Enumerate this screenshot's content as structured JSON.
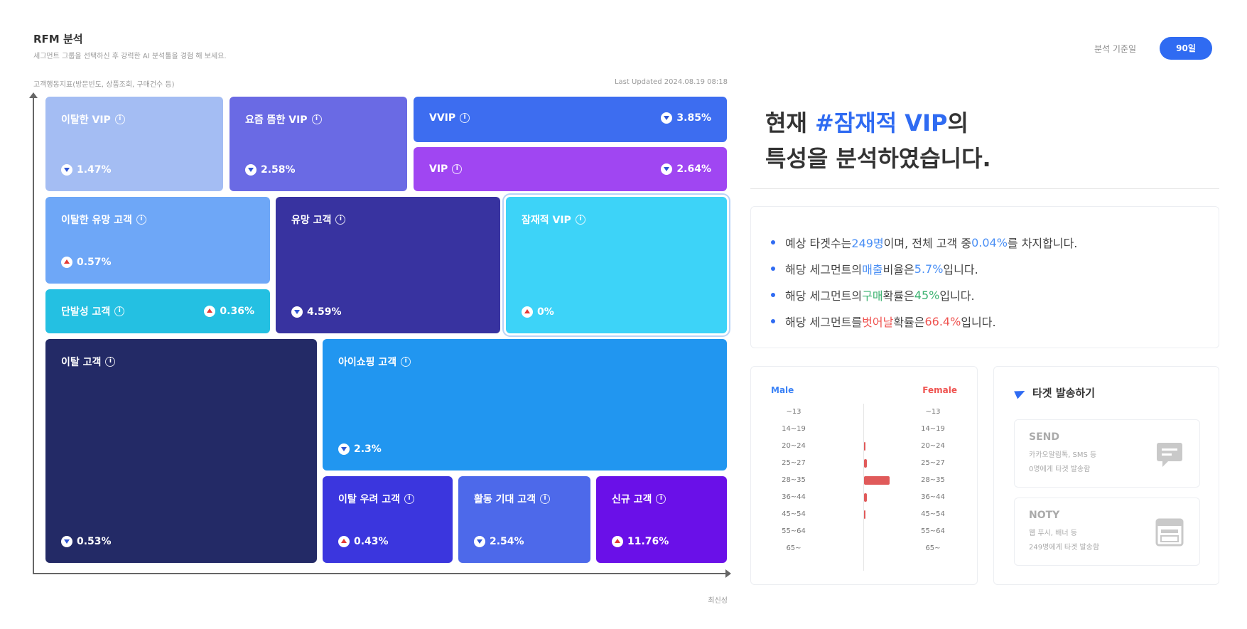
{
  "header": {
    "title": "RFM 분석",
    "subtitle": "세그먼트 그룹을 선택하신 후 강력한 AI 분석툴을 경험 해 보세요.",
    "period_label": "분석 기준일",
    "period_value": "90일"
  },
  "chart_meta": {
    "y_axis_label": "고객행동지표(방문빈도, 상품조회, 구매건수 등)",
    "last_updated": "Last Updated 2024.08.19 08:18",
    "x_axis_label": "최신성"
  },
  "segments": [
    {
      "name": "이탈한 VIP",
      "value": "1.47%",
      "trend": "down",
      "color": "#a4bdf3"
    },
    {
      "name": "요즘 뜸한 VIP",
      "value": "2.58%",
      "trend": "down",
      "color": "#6a6ae4"
    },
    {
      "name": "VVIP",
      "value": "3.85%",
      "trend": "down",
      "color": "#3d6df0"
    },
    {
      "name": "VIP",
      "value": "2.64%",
      "trend": "down",
      "color": "#a046f2"
    },
    {
      "name": "이탈한 유망 고객",
      "value": "0.57%",
      "trend": "up",
      "color": "#6ea7f7"
    },
    {
      "name": "유망 고객",
      "value": "4.59%",
      "trend": "down",
      "color": "#3833a0"
    },
    {
      "name": "잠재적 VIP",
      "value": "0%",
      "trend": "up",
      "color": "#3dd3f8"
    },
    {
      "name": "단발성 고객",
      "value": "0.36%",
      "trend": "up",
      "color": "#24c0e2"
    },
    {
      "name": "이탈 고객",
      "value": "0.53%",
      "trend": "down",
      "color": "#232a66"
    },
    {
      "name": "아이쇼핑 고객",
      "value": "2.3%",
      "trend": "down",
      "color": "#2196f0"
    },
    {
      "name": "이탈 우려 고객",
      "value": "0.43%",
      "trend": "up",
      "color": "#3b36de"
    },
    {
      "name": "활동 기대 고객",
      "value": "2.54%",
      "trend": "down",
      "color": "#4d69ea"
    },
    {
      "name": "신규 고객",
      "value": "11.76%",
      "trend": "up",
      "color": "#6a10e8"
    }
  ],
  "analysis": {
    "headline_prefix": "현재 ",
    "headline_highlight": "#잠재적 VIP",
    "headline_suffix": "의",
    "headline_line2": "특성을 분석하였습니다.",
    "bullets": [
      {
        "p1": "예상 타겟수는 ",
        "v1": "249명",
        "p2": "이며, 전체 고객 중 ",
        "v2": "0.04%",
        "p3": "를 차지합니다."
      },
      {
        "p1": "해당 세그먼트의 ",
        "v1": "매출",
        "p2": "비율은 ",
        "v2": "5.7%",
        "p3": "입니다."
      },
      {
        "p1": "해당 세그먼트의 ",
        "v1": "구매",
        "p2": "확률은 ",
        "v2": "45%",
        "p3": "입니다."
      },
      {
        "p1": "해당 세그먼트를 ",
        "v1": "벗어날",
        "p2": "확률은 ",
        "v2": "66.4%",
        "p3": "입니다."
      }
    ]
  },
  "pyramid": {
    "male_label": "Male",
    "female_label": "Female",
    "age_groups": [
      "~13",
      "14~19",
      "20~24",
      "25~27",
      "28~35",
      "36~44",
      "45~54",
      "55~64",
      "65~"
    ],
    "male_values": [
      0,
      0,
      0,
      0,
      0,
      0,
      0,
      0,
      0
    ],
    "female_values": [
      0,
      0,
      0.05,
      0.1,
      1.0,
      0.1,
      0.05,
      0,
      0
    ]
  },
  "send": {
    "title": "타겟 발송하기",
    "options": [
      {
        "title": "SEND",
        "line1": "카카오알림톡, SMS 등",
        "line2": "0명에게 타겟 발송함",
        "icon": "chat-icon"
      },
      {
        "title": "NOTY",
        "line1": "웹 푸시, 배너 등",
        "line2": "249명에게 타겟 발송함",
        "icon": "layout-icon"
      }
    ]
  }
}
